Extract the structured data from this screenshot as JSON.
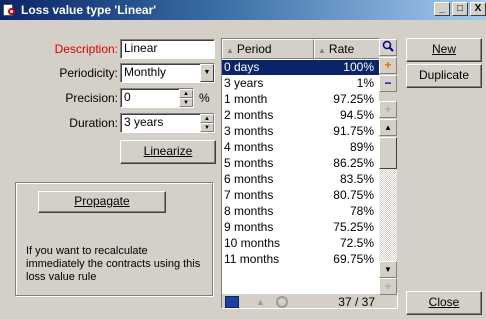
{
  "window": {
    "title": "Loss value type 'Linear'",
    "app_icon": "magnifier-page-icon",
    "title_color": "#0a246a"
  },
  "window_buttons": {
    "minimize": "_",
    "maximize": "□",
    "close": "X"
  },
  "form": {
    "description": {
      "label": "Description:",
      "value": "Linear",
      "label_color": "#e00000"
    },
    "periodicity": {
      "label": "Periodicity:",
      "value": "Monthly"
    },
    "precision": {
      "label": "Precision:",
      "value": "0",
      "unit": "%"
    },
    "duration": {
      "label": "Duration:",
      "value": "3 years"
    },
    "linearize_button": "Linearize"
  },
  "propagate": {
    "button": "Propagate",
    "help_text": "If you want to recalculate immediately the contracts using this loss value rule"
  },
  "table": {
    "columns": [
      "Period",
      "Rate"
    ],
    "rows": [
      {
        "period": "0 days",
        "rate": "100%",
        "selected": true
      },
      {
        "period": "3 years",
        "rate": "1%"
      },
      {
        "period": "1 month",
        "rate": "97.25%"
      },
      {
        "period": "2 months",
        "rate": "94.5%"
      },
      {
        "period": "3 months",
        "rate": "91.75%"
      },
      {
        "period": "4 months",
        "rate": "89%"
      },
      {
        "period": "5 months",
        "rate": "86.25%"
      },
      {
        "period": "6 months",
        "rate": "83.5%"
      },
      {
        "period": "7 months",
        "rate": "80.75%"
      },
      {
        "period": "8 months",
        "rate": "78%"
      },
      {
        "period": "9 months",
        "rate": "75.25%"
      },
      {
        "period": "10 months",
        "rate": "72.5%"
      },
      {
        "period": "11 months",
        "rate": "69.75%"
      }
    ],
    "count": "37 / 37",
    "selection_color": "#0a246a"
  },
  "actions": {
    "new": "New",
    "duplicate": "Duplicate",
    "close": "Close"
  }
}
